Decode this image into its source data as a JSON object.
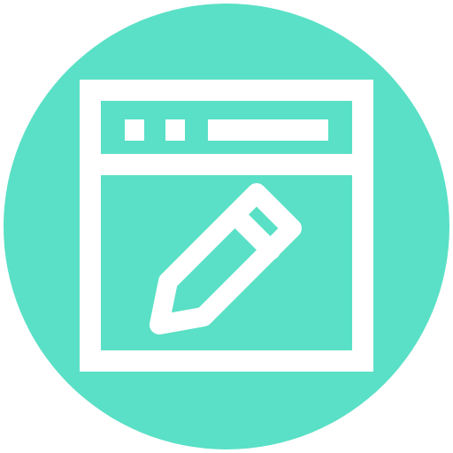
{
  "icon": {
    "name": "browser-edit-icon",
    "background_color": "#5AE0C6",
    "foreground_color": "#FFFFFF"
  }
}
